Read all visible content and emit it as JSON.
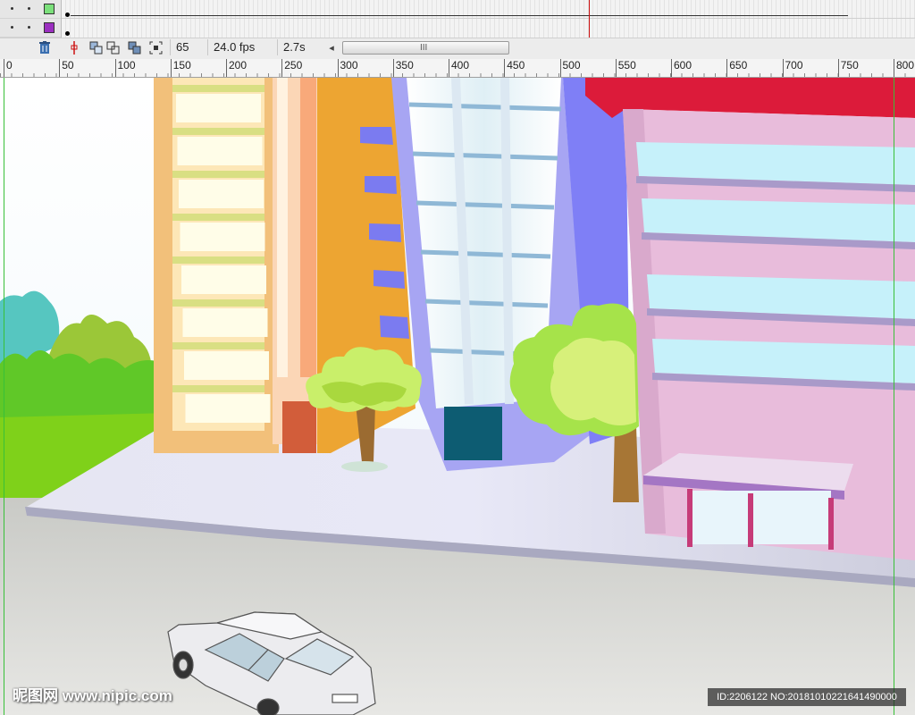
{
  "timeline": {
    "layers": [
      {
        "color": "#7be07b"
      },
      {
        "color": "#9b2fc0"
      }
    ],
    "current_frame": "65",
    "frame_rate": "24.0 fps",
    "elapsed_time": "2.7s",
    "scroll_grip": "III",
    "scroll_left": "◂",
    "icons": {
      "trash": "trash-icon",
      "center_frame": "center-frame-icon",
      "onion_skin": "onion-skin-icon",
      "onion_skin_outlines": "onion-skin-outlines-icon",
      "edit_multiple_frames": "edit-multiple-frames-icon",
      "modify_onion_markers": "modify-onion-markers-icon"
    }
  },
  "ruler": {
    "labels": [
      "0",
      "50",
      "100",
      "150",
      "200",
      "250",
      "300",
      "350",
      "400",
      "450",
      "500",
      "550",
      "600",
      "650",
      "700",
      "750",
      "800"
    ]
  },
  "stage": {
    "sky_color": "#f2fafd",
    "road_color": "#cfd0ca",
    "sidewalk_color": "#dcdcec"
  },
  "watermark": {
    "text": "昵图网 www.nipic.com",
    "id_text": "ID:2206122 NO:20181010221641490000"
  }
}
